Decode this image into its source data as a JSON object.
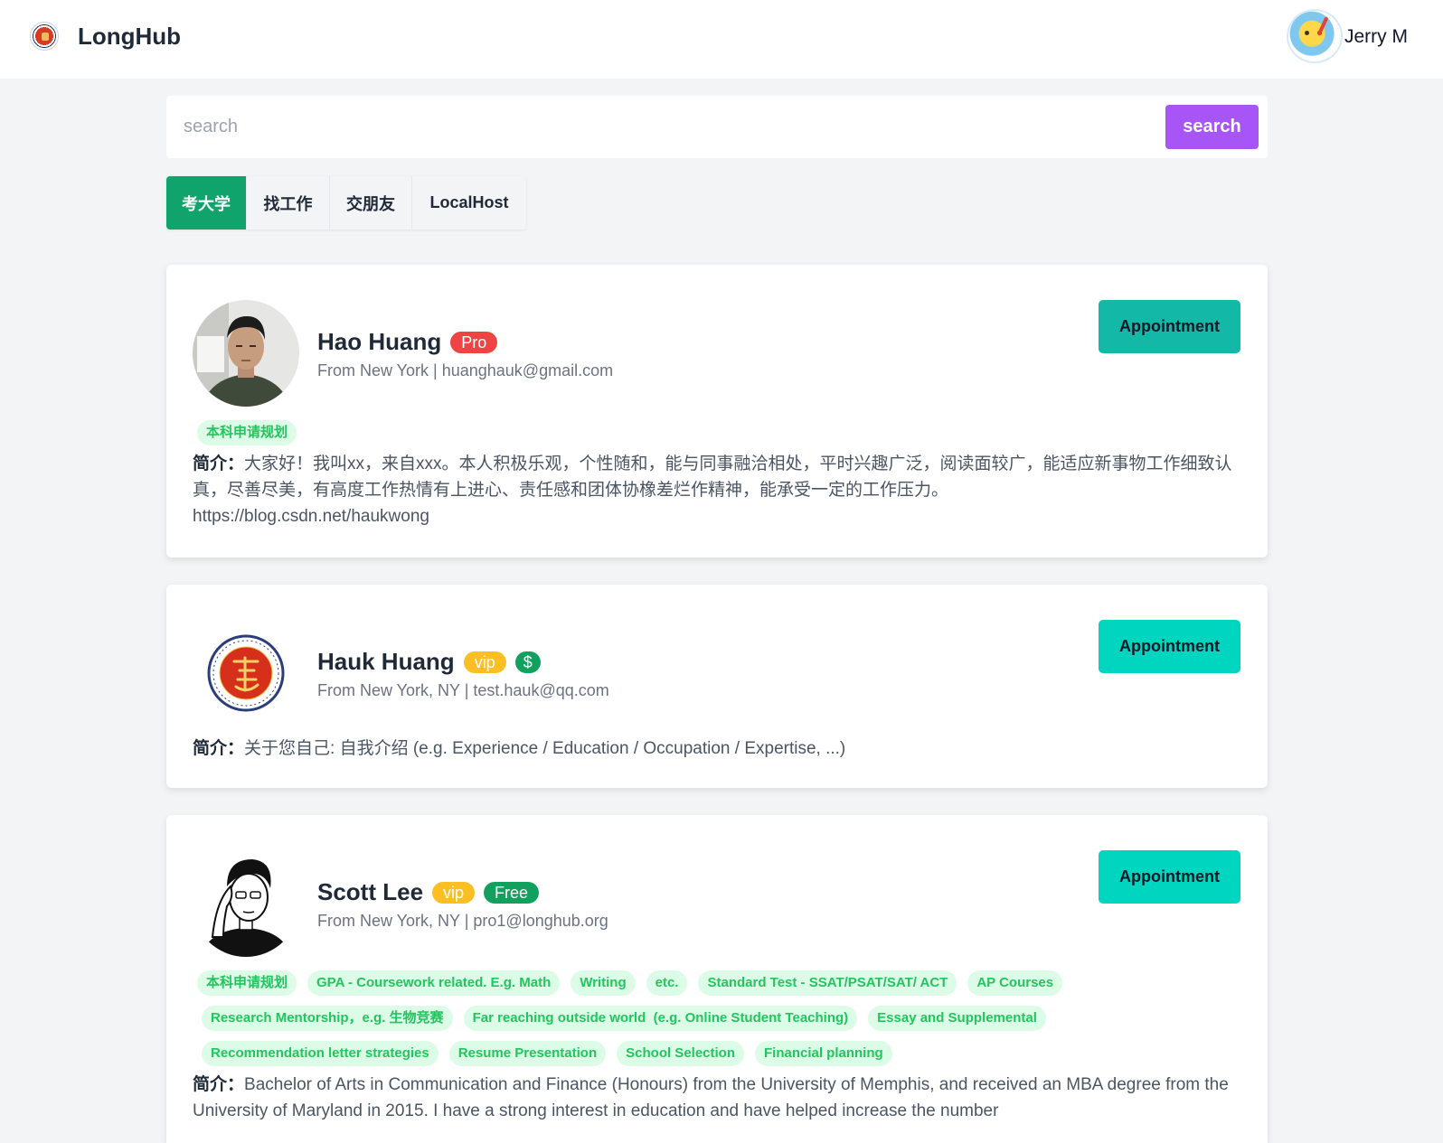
{
  "header": {
    "brand_name": "LongHub",
    "user_name": "Jerry M"
  },
  "search": {
    "placeholder": "search",
    "button_label": "search"
  },
  "tabs": [
    {
      "label": "考大学",
      "active": true
    },
    {
      "label": "找工作",
      "active": false
    },
    {
      "label": "交朋友",
      "active": false
    },
    {
      "label": "LocalHost",
      "active": false
    }
  ],
  "colors": {
    "brand_green": "#10a36b",
    "search_purple": "#a855f7",
    "pro_red": "#ef4444",
    "vip_yellow": "#fbbf24",
    "free_green": "#12a05f",
    "appt_teal_dark": "#14b8a6",
    "appt_teal_light": "#00d5bf",
    "tag_bg": "#dcfce7",
    "tag_text": "#22c55e"
  },
  "bio_label": "简介：",
  "appointment_label": "Appointment",
  "profiles": [
    {
      "name": "Hao Huang",
      "badges": [
        "Pro"
      ],
      "meta": "From New York | huanghauk@gmail.com",
      "tags": [
        "本科申请规划"
      ],
      "bio": "大家好！我叫xx，来自xxx。本人积极乐观，个性随和，能与同事融洽相处，平时兴趣广泛，阅读面较广，能适应新事物工作细致认真，尽善尽美，有高度工作热情有上进心、责任感和团体协橡差烂作精神，能承受一定的工作压力。",
      "bio_link": "https://blog.csdn.net/haukwong"
    },
    {
      "name": "Hauk Huang",
      "badges": [
        "vip",
        "$"
      ],
      "meta": "From New York, NY | test.hauk@qq.com",
      "tags": [],
      "bio": "关于您自己: 自我介绍 (e.g. Experience / Education / Occupation / Expertise, ...)",
      "bio_link": ""
    },
    {
      "name": "Scott Lee",
      "badges": [
        "vip",
        "Free"
      ],
      "meta": "From New York, NY | pro1@longhub.org",
      "tags": [
        "本科申请规划",
        "GPA - Coursework related. E.g. Math",
        "Writing",
        "etc.",
        "Standard Test - SSAT/PSAT/SAT/ ACT",
        "AP Courses",
        "Research Mentorship，e.g. 生物竞赛",
        "Far reaching outside world  (e.g. Online Student Teaching)",
        "Essay and Supplemental",
        "Recommendation letter strategies",
        "Resume Presentation",
        "School Selection",
        "Financial planning"
      ],
      "bio": "Bachelor of Arts in Communication and Finance (Honours) from the University of Memphis, and received an MBA degree from the University of Maryland in 2015. I have a strong interest in education and have helped increase the number",
      "bio_link": ""
    }
  ]
}
